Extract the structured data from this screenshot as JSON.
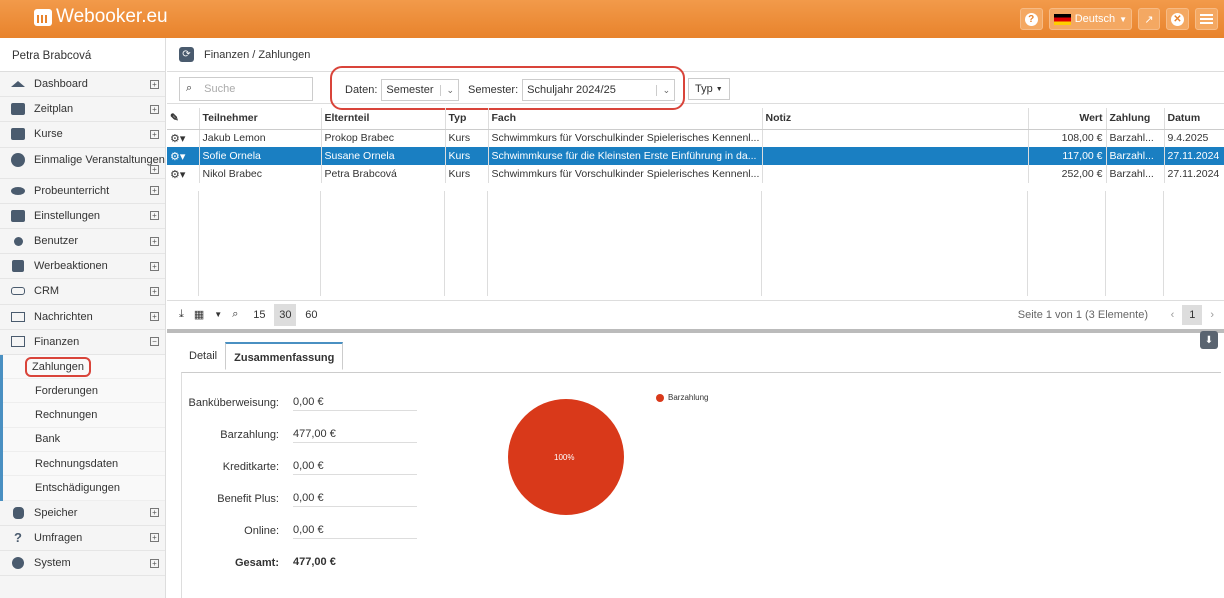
{
  "app": {
    "logo_text": "Webooker.eu",
    "language": "Deutsch",
    "user": "Petra Brabcová"
  },
  "colors": {
    "brand": "#e8832c",
    "selection": "#1a7fc2",
    "highlight": "#d9443a",
    "pie": "#d9391a"
  },
  "sidebar": {
    "items": [
      {
        "label": "Dashboard",
        "icon": "house-icon"
      },
      {
        "label": "Zeitplan",
        "icon": "calendar-icon"
      },
      {
        "label": "Kurse",
        "icon": "book-icon"
      },
      {
        "label": "Einmalige Veranstaltungen",
        "icon": "soccer-icon"
      },
      {
        "label": "Probeunterricht",
        "icon": "eye-slash-icon"
      },
      {
        "label": "Einstellungen",
        "icon": "sliders-icon"
      },
      {
        "label": "Benutzer",
        "icon": "users-icon"
      },
      {
        "label": "Werbeaktionen",
        "icon": "gift-icon"
      },
      {
        "label": "CRM",
        "icon": "handshake-icon"
      },
      {
        "label": "Nachrichten",
        "icon": "envelope-icon"
      },
      {
        "label": "Finanzen",
        "icon": "money-icon"
      }
    ],
    "finance_sub": [
      "Zahlungen",
      "Forderungen",
      "Rechnungen",
      "Bank",
      "Rechnungsdaten",
      "Entschädigungen"
    ],
    "bottom_items": [
      {
        "label": "Speicher",
        "icon": "database-icon"
      },
      {
        "label": "Umfragen",
        "icon": "question-icon"
      },
      {
        "label": "System",
        "icon": "cogs-icon"
      }
    ]
  },
  "breadcrumb": "Finanzen / Zahlungen",
  "toolbar": {
    "search_placeholder": "Suche",
    "daten_label": "Daten:",
    "daten_value": "Semester",
    "semester_label": "Semester:",
    "semester_value": "Schuljahr 2024/25",
    "typ_label": "Typ"
  },
  "table": {
    "columns": [
      "Teilnehmer",
      "Elternteil",
      "Typ",
      "Fach",
      "Notiz",
      "Wert",
      "Zahlung",
      "Datum"
    ],
    "rows": [
      {
        "teilnehmer": "Jakub Lemon",
        "elternteil": "Prokop Brabec",
        "typ": "Kurs",
        "fach": "Schwimmkurs für Vorschulkinder Spielerisches Kennenl...",
        "notiz": "",
        "wert": "108,00 €",
        "zahlung": "Barzahl...",
        "datum": "9.4.2025",
        "selected": false
      },
      {
        "teilnehmer": "Sofie Ornela",
        "elternteil": "Susane Ornela",
        "typ": "Kurs",
        "fach": "Schwimmkurse für die Kleinsten Erste Einführung in da...",
        "notiz": "",
        "wert": "117,00 €",
        "zahlung": "Barzahl...",
        "datum": "27.11.2024",
        "selected": true
      },
      {
        "teilnehmer": "Nikol Brabec",
        "elternteil": "Petra Brabcová",
        "typ": "Kurs",
        "fach": "Schwimmkurs für Vorschulkinder Spielerisches Kennenl...",
        "notiz": "",
        "wert": "252,00 €",
        "zahlung": "Barzahl...",
        "datum": "27.11.2024",
        "selected": false
      }
    ]
  },
  "pager": {
    "sizes": [
      "15",
      "30",
      "60"
    ],
    "active_size": "30",
    "info": "Seite 1 von 1 (3 Elemente)",
    "current_page": "1"
  },
  "tabs": [
    "Detail",
    "Zusammenfassung"
  ],
  "summary": [
    {
      "label": "Banküberweisung:",
      "value": "0,00 €"
    },
    {
      "label": "Barzahlung:",
      "value": "477,00 €"
    },
    {
      "label": "Kreditkarte:",
      "value": "0,00 €"
    },
    {
      "label": "Benefit Plus:",
      "value": "0,00 €"
    },
    {
      "label": "Online:",
      "value": "0,00 €"
    },
    {
      "label": "Gesamt:",
      "value": "477,00 €"
    }
  ],
  "chart_data": {
    "type": "pie",
    "categories": [
      "Barzahlung"
    ],
    "values": [
      100
    ],
    "data_labels": [
      "100%"
    ],
    "legend": "top-right"
  }
}
